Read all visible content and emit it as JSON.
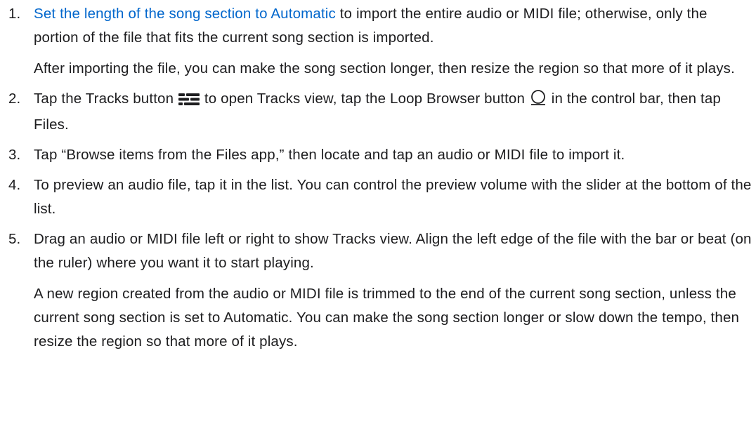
{
  "steps": [
    {
      "number": "1.",
      "link_text": "Set the length of the song section to Automatic",
      "text_after_link": " to import the entire audio or MIDI file; otherwise, only the portion of the file that fits the current song section is imported.",
      "note": "After importing the file, you can make the song section longer, then resize the region so that more of it plays."
    },
    {
      "number": "2.",
      "text_1": "Tap the Tracks button ",
      "text_2": " to open Tracks view, tap the Loop Browser button ",
      "text_3": " in the control bar, then tap Files.",
      "icons": [
        "tracks-icon",
        "loop-browser-icon"
      ]
    },
    {
      "number": "3.",
      "text": "Tap “Browse items from the Files app,” then locate and tap an audio or MIDI file to import it."
    },
    {
      "number": "4.",
      "text": "To preview an audio file, tap it in the list. You can control the preview volume with the slider at the bottom of the list."
    },
    {
      "number": "5.",
      "text": "Drag an audio or MIDI file left or right to show Tracks view. Align the left edge of the file with the bar or beat (on the ruler) where you want it to start playing.",
      "note": "A new region created from the audio or MIDI file is trimmed to the end of the current song section, unless the current song section is set to Automatic. You can make the song section longer or slow down the tempo, then resize the region so that more of it plays."
    }
  ],
  "colors": {
    "text": "#1d1d1f",
    "link": "#0066cc",
    "background": "#ffffff"
  }
}
